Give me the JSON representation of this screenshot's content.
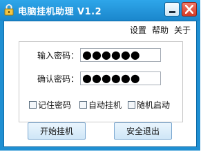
{
  "window": {
    "title": "电脑挂机助理 V1.2",
    "icon": "lock-icon",
    "controls": {
      "minimize": "minimize-icon",
      "close": "close-icon"
    }
  },
  "menu": {
    "items": [
      "设置",
      "帮助",
      "关于"
    ]
  },
  "form": {
    "password_label": "输入密码：",
    "password_value": "●●●●●●",
    "confirm_label": "确认密码：",
    "confirm_value": "●●●●●●"
  },
  "options": [
    {
      "label": "记住密码",
      "checked": false
    },
    {
      "label": "自动挂机",
      "checked": false
    },
    {
      "label": "随机启动",
      "checked": false
    }
  ],
  "buttons": {
    "start": "开始挂机",
    "exit": "安全退出"
  },
  "colors": {
    "titlebar": "#1a86cc",
    "close": "#d33a24"
  }
}
